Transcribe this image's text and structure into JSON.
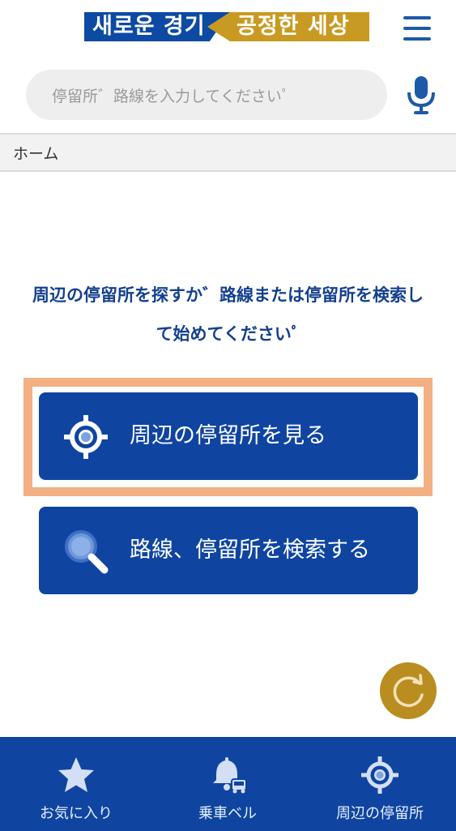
{
  "header": {
    "logo_left": "새로운 경기",
    "logo_right": "공정한 세상",
    "menu_icon": "hamburger-menu-icon"
  },
  "search": {
    "placeholder": "停留所゛路線を入力してくださいﾟ",
    "mic_icon": "microphone-icon"
  },
  "breadcrumb": {
    "home": "ホーム"
  },
  "instruction": {
    "line1": "周辺の停留所を探すか゛路線または停留所を検索し",
    "line2": "て始めてくださいﾟ"
  },
  "actions": {
    "nearby_label": "周辺の停留所を見る",
    "nearby_icon": "location-target-icon",
    "search_label": "路線、停留所を検索する",
    "search_icon": "magnifier-icon",
    "highlight_color": "#f2b083"
  },
  "refresh": {
    "icon": "refresh-icon"
  },
  "bottom_nav": {
    "items": [
      {
        "label": "お気に入り",
        "icon": "star-icon"
      },
      {
        "label": "乗車ベル",
        "icon": "bell-bus-icon"
      },
      {
        "label": "周辺の停留所",
        "icon": "location-target-icon"
      }
    ]
  },
  "colors": {
    "primary": "#0f45a1",
    "accent_gold": "#b98d1f",
    "text_blue": "#14408e"
  }
}
